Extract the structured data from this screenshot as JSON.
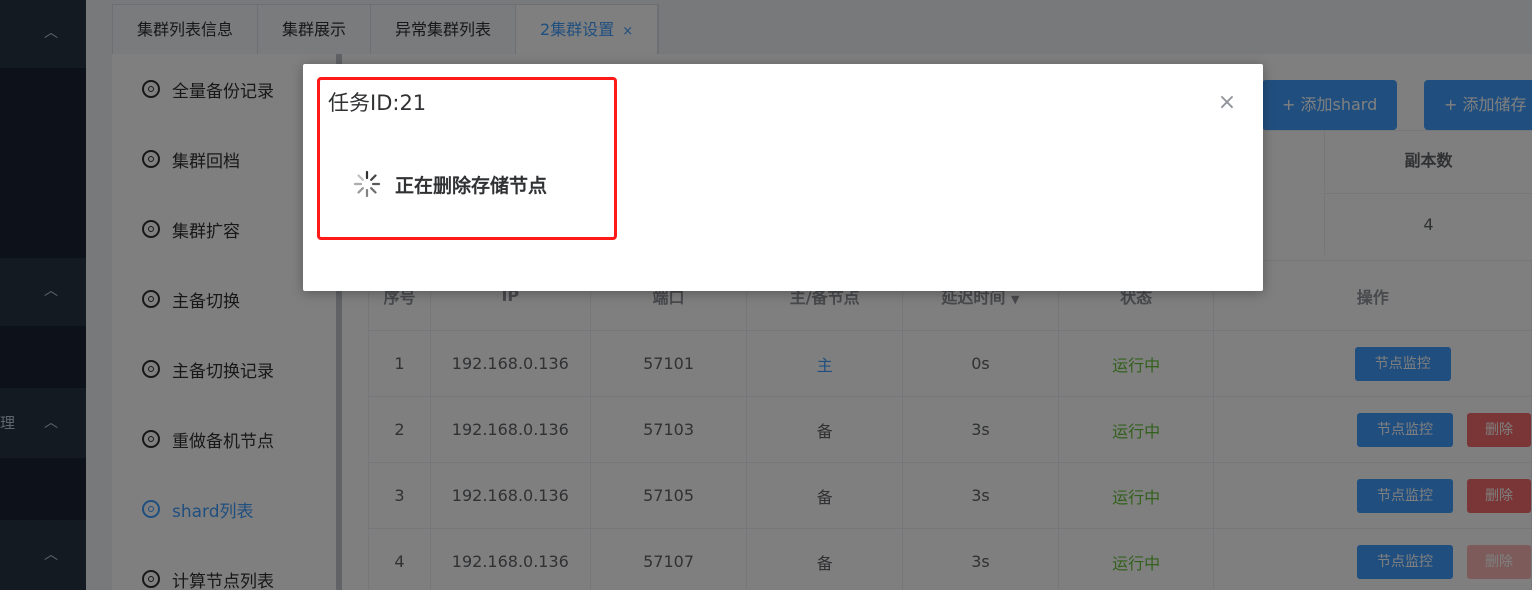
{
  "nav": {
    "partial_label": "理"
  },
  "tabs": [
    {
      "label": "集群列表信息"
    },
    {
      "label": "集群展示"
    },
    {
      "label": "异常集群列表"
    },
    {
      "label": "2集群设置",
      "close": "×"
    }
  ],
  "subnav": [
    {
      "label": "全量备份记录"
    },
    {
      "label": "集群回档"
    },
    {
      "label": "集群扩容"
    },
    {
      "label": "主备切换"
    },
    {
      "label": "主备切换记录"
    },
    {
      "label": "重做备机节点"
    },
    {
      "label": "shard列表"
    },
    {
      "label": "计算节点列表"
    }
  ],
  "toolbar": {
    "add_shard": "+ 添加shard",
    "add_storage": "+ 添加储存"
  },
  "info": {
    "replica_header": "副本数",
    "replica_value": "4"
  },
  "table": {
    "headers": [
      "序号",
      "IP",
      "端口",
      "主/备节点",
      "延迟时间",
      "状态",
      "操作"
    ],
    "rows": [
      {
        "idx": "1",
        "ip": "192.168.0.136",
        "port": "57101",
        "role": "主",
        "delay": "0s",
        "state": "运行中",
        "monitor": "节点监控"
      },
      {
        "idx": "2",
        "ip": "192.168.0.136",
        "port": "57103",
        "role": "备",
        "delay": "3s",
        "state": "运行中",
        "monitor": "节点监控",
        "delete": "删除"
      },
      {
        "idx": "3",
        "ip": "192.168.0.136",
        "port": "57105",
        "role": "备",
        "delay": "3s",
        "state": "运行中",
        "monitor": "节点监控",
        "delete": "删除"
      },
      {
        "idx": "4",
        "ip": "192.168.0.136",
        "port": "57107",
        "role": "备",
        "delay": "3s",
        "state": "运行中",
        "monitor": "节点监控",
        "delete": "删除"
      }
    ]
  },
  "dialog": {
    "title": "任务ID:21",
    "close": "×",
    "loading_text": "正在删除存储节点"
  },
  "colors": {
    "primary": "#409eff",
    "success": "#67c23a",
    "danger": "#f56c6c",
    "highlight": "#ff1a1a"
  }
}
